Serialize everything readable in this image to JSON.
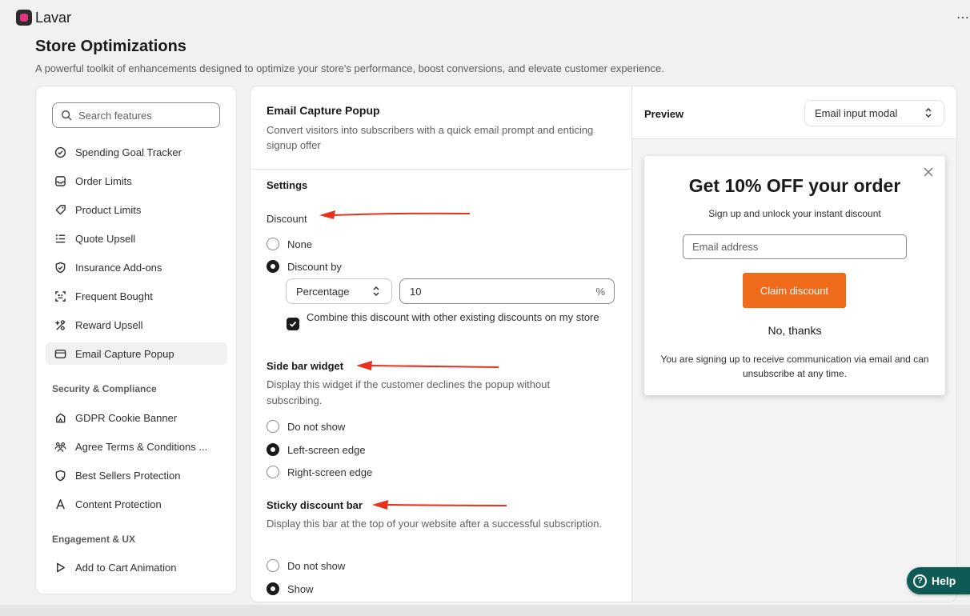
{
  "app": {
    "name": "Lavar",
    "more": "⋯"
  },
  "page": {
    "title": "Store Optimizations",
    "subtitle": "A powerful toolkit of enhancements designed to optimize your store's performance, boost conversions, and elevate customer experience."
  },
  "sidebar": {
    "search_placeholder": "Search features",
    "items": [
      {
        "label": "Spending Goal Tracker",
        "icon": "check-circle-icon"
      },
      {
        "label": "Order Limits",
        "icon": "inbox-icon"
      },
      {
        "label": "Product Limits",
        "icon": "tag-icon"
      },
      {
        "label": "Quote Upsell",
        "icon": "list-icon"
      },
      {
        "label": "Insurance Add-ons",
        "icon": "shield-check-icon"
      },
      {
        "label": "Frequent Bought",
        "icon": "scan-icon"
      },
      {
        "label": "Reward Upsell",
        "icon": "sparkle-icon"
      },
      {
        "label": "Email Capture Popup",
        "icon": "email-icon",
        "active": true
      }
    ],
    "section_security": "Security & Compliance",
    "security_items": [
      {
        "label": "GDPR Cookie Banner",
        "icon": "cookie-icon"
      },
      {
        "label": "Agree Terms & Conditions ...",
        "icon": "people-icon"
      },
      {
        "label": "Best Sellers Protection",
        "icon": "shield-icon"
      },
      {
        "label": "Content Protection",
        "icon": "text-icon"
      }
    ],
    "section_engagement": "Engagement & UX",
    "engagement_items": [
      {
        "label": "Add to Cart Animation",
        "icon": "play-icon"
      }
    ]
  },
  "feature": {
    "title": "Email Capture Popup",
    "description": "Convert visitors into subscribers with a quick email prompt and enticing signup offer",
    "settings_title": "Settings",
    "discount": {
      "label": "Discount",
      "options": [
        "None",
        "Discount by"
      ],
      "selected": "Discount by",
      "type_value": "Percentage",
      "amount": "10",
      "amount_suffix": "%",
      "combine_label": "Combine this discount with other existing discounts on my store",
      "combine_checked": true
    },
    "sidebar_widget": {
      "label": "Side bar widget",
      "help": "Display this widget if the customer declines the popup without subscribing.",
      "options": [
        "Do not show",
        "Left-screen edge",
        "Right-screen edge"
      ],
      "selected": "Left-screen edge"
    },
    "sticky_bar": {
      "label": "Sticky discount bar",
      "help": "Display this bar at the top of your website after a successful subscription.",
      "options": [
        "Do not show",
        "Show"
      ],
      "selected": "Show"
    }
  },
  "preview": {
    "label": "Preview",
    "mode": "Email input modal",
    "modal": {
      "title": "Get 10% OFF your order",
      "subtitle": "Sign up and unlock your instant discount",
      "email_placeholder": "Email address",
      "claim_button": "Claim discount",
      "decline": "No, thanks",
      "legal": "You are signing up to receive communication via email and can unsubscribe at any time."
    }
  },
  "help_button": "Help",
  "colors": {
    "accent": "#f06a1c",
    "help": "#0e5a54",
    "annotation": "#e8301a"
  }
}
